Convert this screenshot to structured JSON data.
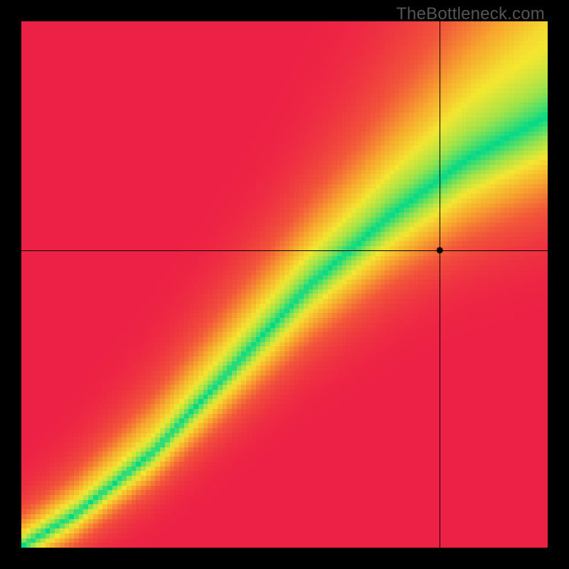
{
  "watermark": "TheBottleneck.com",
  "chart_data": {
    "type": "heatmap",
    "title": "",
    "xlabel": "",
    "ylabel": "",
    "xlim": [
      0,
      1
    ],
    "ylim": [
      0,
      1
    ],
    "grid": false,
    "legend": false,
    "crosshair": {
      "x": 0.795,
      "y": 0.565
    },
    "marker": {
      "x": 0.795,
      "y": 0.565
    },
    "ridge": {
      "description": "Green ideal-balance ridge running from bottom-left to top-right; widens toward top; slight S-curve near origin.",
      "control_points_xy": [
        [
          0.0,
          0.0
        ],
        [
          0.1,
          0.06
        ],
        [
          0.25,
          0.18
        ],
        [
          0.4,
          0.34
        ],
        [
          0.55,
          0.5
        ],
        [
          0.7,
          0.63
        ],
        [
          0.85,
          0.74
        ],
        [
          1.0,
          0.82
        ]
      ],
      "base_half_width": 0.028,
      "width_growth": 0.1,
      "top_fan_extra": 0.06
    },
    "colorscale": {
      "stops": [
        {
          "t": 0.0,
          "color": "#00d989"
        },
        {
          "t": 0.22,
          "color": "#9fe34a"
        },
        {
          "t": 0.38,
          "color": "#f4e631"
        },
        {
          "t": 0.58,
          "color": "#f7a72e"
        },
        {
          "t": 0.78,
          "color": "#f2553a"
        },
        {
          "t": 1.0,
          "color": "#ed2045"
        }
      ]
    }
  }
}
